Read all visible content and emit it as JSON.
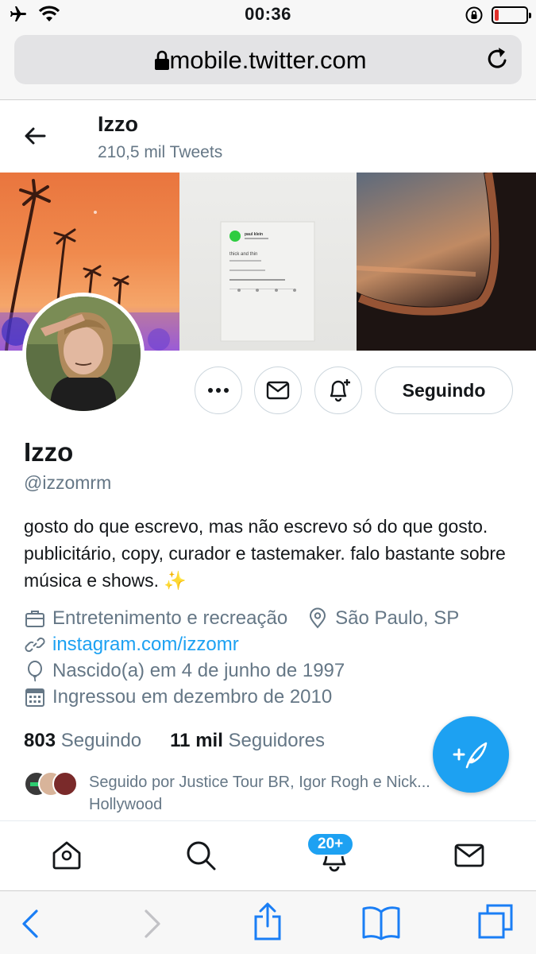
{
  "status_bar": {
    "time": "00:36",
    "icons": [
      "airplane-icon",
      "wifi-icon",
      "orientation-lock-icon",
      "battery-icon"
    ],
    "battery_color": "#e0302b"
  },
  "browser": {
    "url": "mobile.twitter.com",
    "icons": [
      "lock-icon",
      "reload-icon"
    ]
  },
  "profile_header": {
    "name": "Izzo",
    "tweets_count": "210,5 mil Tweets"
  },
  "profile": {
    "display_name": "Izzo",
    "handle": "@izzomrm",
    "bio": "gosto do que escrevo, mas não escrevo só do que gosto. publicitário, copy, curador e tastemaker. falo bastante sobre música e shows. ✨",
    "category": "Entretenimento e recreação",
    "location": "São Paulo, SP",
    "website": "instagram.com/izzomr",
    "birthday": "Nascido(a) em 4 de junho de 1997",
    "joined": "Ingressou em dezembro de 2010",
    "following_count": "803",
    "following_label": "Seguindo",
    "followers_count": "11 mil",
    "followers_label": "Seguidores",
    "followed_by": "Seguido por Justice Tour BR, Igor Rogh e Nick... Hollywood"
  },
  "actions": {
    "follow_button": "Seguindo",
    "icons": [
      "more-icon",
      "message-icon",
      "notification-bell-plus-icon"
    ]
  },
  "banner": {
    "middle_card_name": "paul klein",
    "middle_card_text": "thick and thin"
  },
  "bottom_nav": {
    "items": [
      "home-icon",
      "search-icon",
      "notifications-icon",
      "messages-icon"
    ],
    "notifications_badge": "20+"
  },
  "safari_toolbar": {
    "items": [
      "back-icon",
      "forward-icon",
      "share-icon",
      "bookmarks-icon",
      "tabs-icon"
    ]
  },
  "colors": {
    "accent": "#1da1f2",
    "secondary_text": "#657786",
    "primary_text": "#14171a"
  }
}
